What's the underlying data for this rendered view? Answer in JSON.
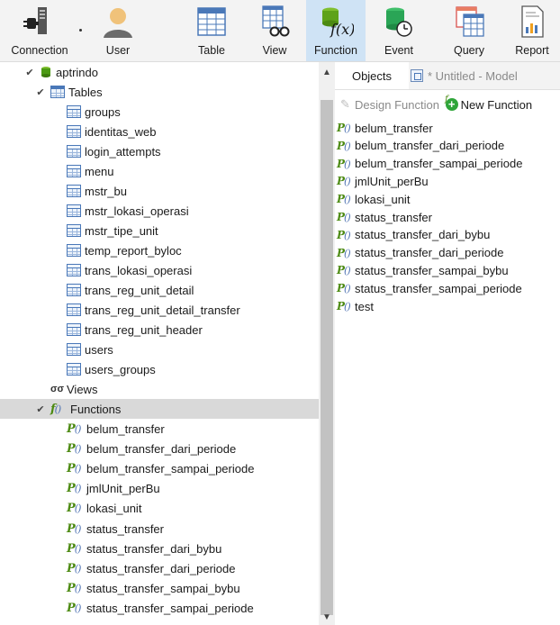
{
  "toolbar": {
    "buttons": [
      {
        "label": "Connection",
        "icon": "plug-icon"
      },
      {
        "label": "User",
        "icon": "user-icon"
      },
      {
        "label": "Table",
        "icon": "table-icon"
      },
      {
        "label": "View",
        "icon": "view-icon"
      },
      {
        "label": "Function",
        "icon": "function-icon",
        "active": true
      },
      {
        "label": "Event",
        "icon": "event-icon"
      },
      {
        "label": "Query",
        "icon": "query-icon"
      },
      {
        "label": "Report",
        "icon": "report-icon"
      }
    ]
  },
  "tree": {
    "database": "aptrindo",
    "tables_label": "Tables",
    "tables": [
      "groups",
      "identitas_web",
      "login_attempts",
      "menu",
      "mstr_bu",
      "mstr_lokasi_operasi",
      "mstr_tipe_unit",
      "temp_report_byloc",
      "trans_lokasi_operasi",
      "trans_reg_unit_detail",
      "trans_reg_unit_detail_transfer",
      "trans_reg_unit_header",
      "users",
      "users_groups"
    ],
    "views_label": "Views",
    "functions_label": "Functions",
    "functions": [
      "belum_transfer",
      "belum_transfer_dari_periode",
      "belum_transfer_sampai_periode",
      "jmlUnit_perBu",
      "lokasi_unit",
      "status_transfer",
      "status_transfer_dari_bybu",
      "status_transfer_dari_periode",
      "status_transfer_sampai_bybu",
      "status_transfer_sampai_periode"
    ]
  },
  "right": {
    "tab_objects": "Objects",
    "tab_model": "* Untitled - Model",
    "design_function": "Design Function",
    "new_function": "New Function",
    "functions": [
      "belum_transfer",
      "belum_transfer_dari_periode",
      "belum_transfer_sampai_periode",
      "jmlUnit_perBu",
      "lokasi_unit",
      "status_transfer",
      "status_transfer_dari_bybu",
      "status_transfer_dari_periode",
      "status_transfer_sampai_bybu",
      "status_transfer_sampai_periode",
      "test"
    ]
  },
  "colors": {
    "toolbar_bg": "#f3f3f3",
    "active_button": "#cfe3f5",
    "selected_row": "#d9d9d9",
    "function_green": "#4c8a12",
    "table_blue": "#4a78b8"
  }
}
